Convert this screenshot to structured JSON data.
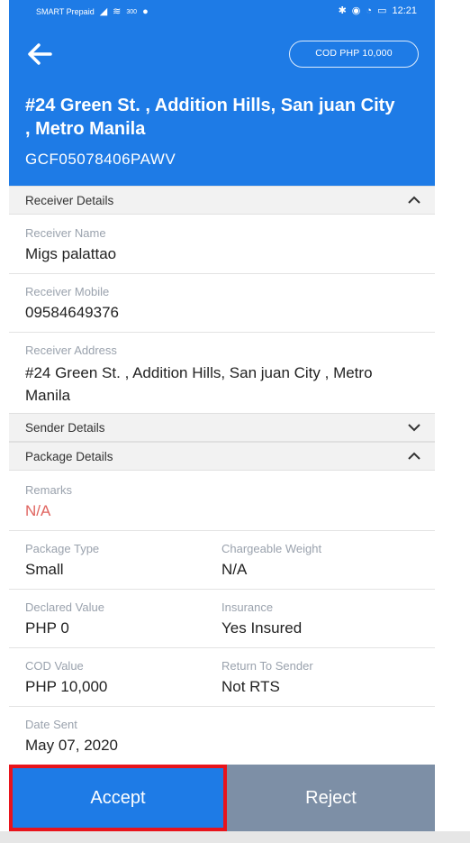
{
  "status_bar": {
    "carrier": "SMART Prepaid",
    "time": "12:21",
    "speed": "300"
  },
  "header": {
    "cod_badge": "COD PHP 10,000",
    "address_title": "#24 Green St. , Addition Hills, San juan City , Metro Manila",
    "tracking_number": "GCF05078406PAWV",
    "background_color": "#1e7be6"
  },
  "receiver_section": {
    "title": "Receiver Details",
    "name_label": "Receiver Name",
    "name_value": "Migs palattao",
    "mobile_label": "Receiver Mobile",
    "mobile_value": "09584649376",
    "address_label": "Receiver Address",
    "address_value": "#24 Green St. , Addition Hills, San juan City , Metro Manila"
  },
  "sender_section": {
    "title": "Sender Details"
  },
  "package_section": {
    "title": "Package Details",
    "remarks_label": "Remarks",
    "remarks_value": "N/A",
    "package_type_label": "Package Type",
    "package_type_value": "Small",
    "chargeable_weight_label": "Chargeable Weight",
    "chargeable_weight_value": "N/A",
    "declared_value_label": "Declared Value",
    "declared_value_value": "PHP 0",
    "insurance_label": "Insurance",
    "insurance_value": "Yes Insured",
    "cod_value_label": "COD Value",
    "cod_value_value": "PHP 10,000",
    "return_to_sender_label": "Return To Sender",
    "return_to_sender_value": "Not RTS",
    "date_sent_label": "Date Sent",
    "date_sent_value": "May 07, 2020"
  },
  "actions": {
    "accept_label": "Accept",
    "reject_label": "Reject",
    "accept_color": "#1e7be6",
    "reject_color": "#7d8fa6",
    "highlight_color": "#e8141c"
  }
}
